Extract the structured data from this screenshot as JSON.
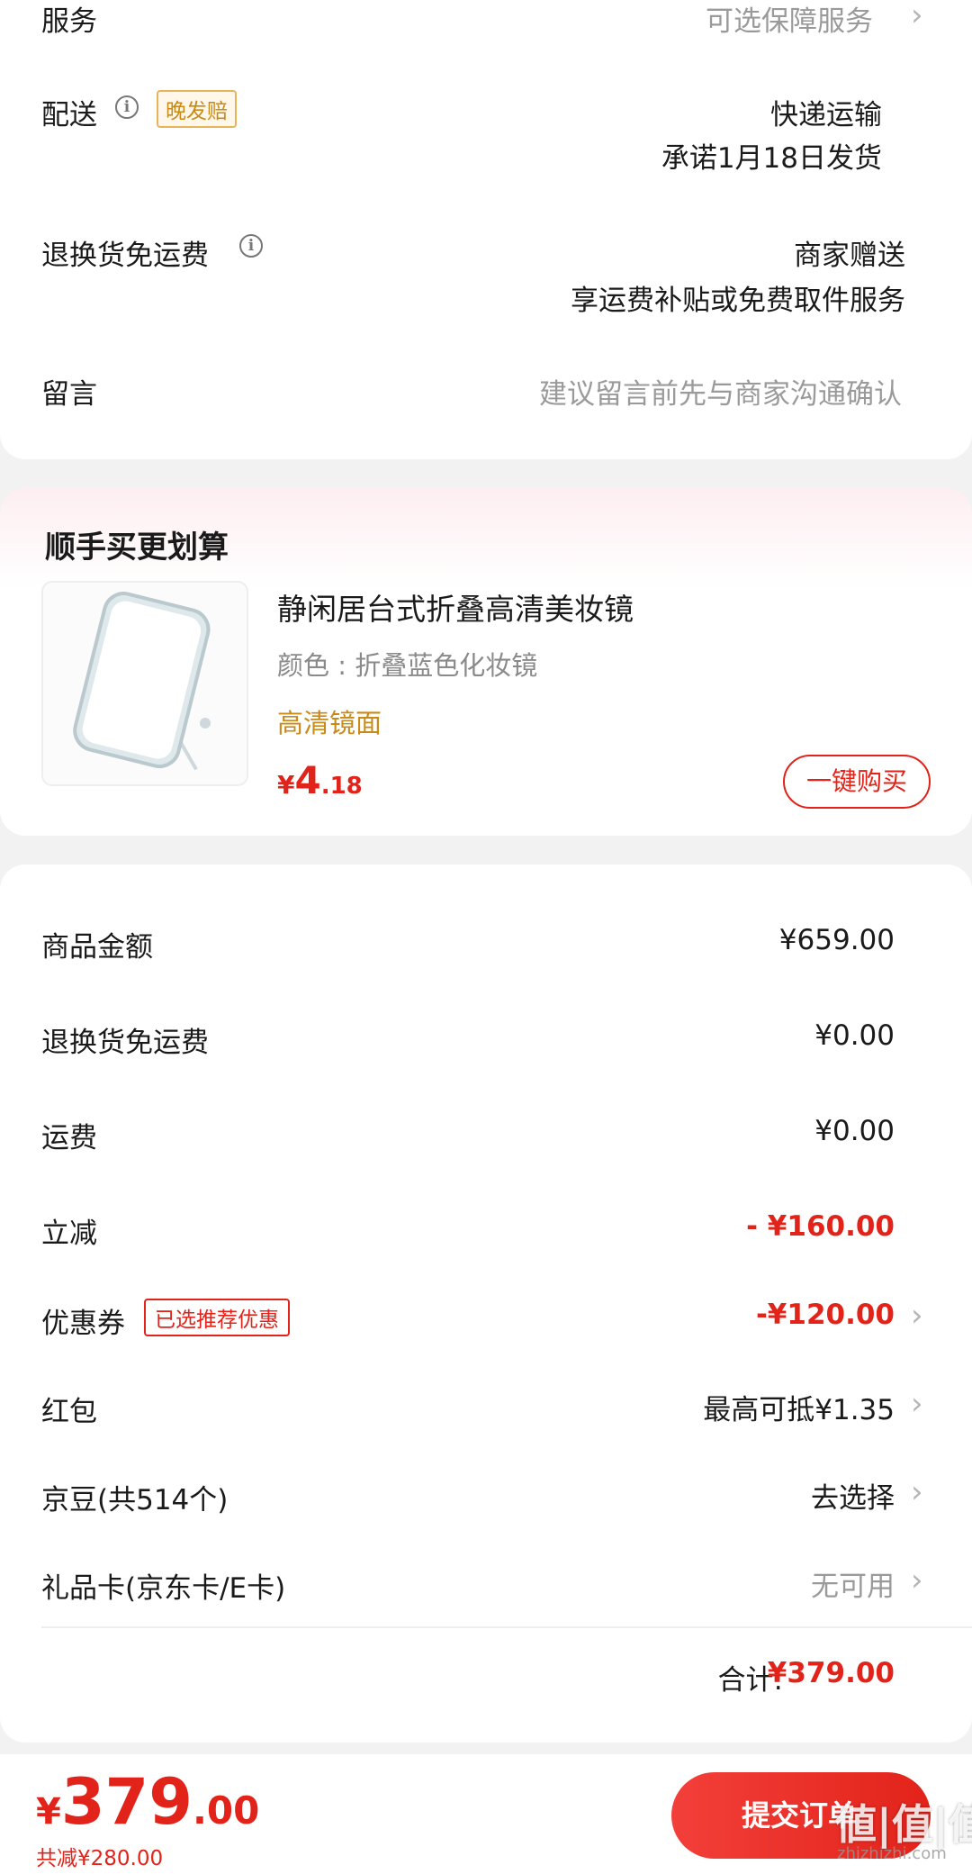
{
  "service": {
    "label": "服务",
    "value": "可选保障服务"
  },
  "delivery": {
    "label": "配送",
    "badge": "晚发赔",
    "method": "快递运输",
    "promise": "承诺1月18日发货"
  },
  "return_shipping": {
    "label": "退换货免运费",
    "value": "商家赠送",
    "desc": "享运费补贴或免费取件服务"
  },
  "message": {
    "label": "留言",
    "placeholder": "建议留言前先与商家沟通确认"
  },
  "addon": {
    "section_title": "顺手买更划算",
    "product_title": "静闲居台式折叠高清美妆镜",
    "spec": "颜色 : 折叠蓝色化妆镜",
    "feature": "高清镜面",
    "price_symbol": "¥",
    "price_int": "4",
    "price_dec": ".18",
    "buy_label": "一键购买"
  },
  "summary": {
    "goods_amount_label": "商品金额",
    "goods_amount": "¥659.00",
    "return_fee_label": "退换货免运费",
    "return_fee": "¥0.00",
    "shipping_label": "运费",
    "shipping": "¥0.00",
    "discount_label": "立减",
    "discount": "- ¥160.00",
    "coupon_label": "优惠券",
    "coupon_tag": "已选推荐优惠",
    "coupon_value": "-¥120.00",
    "redpacket_label": "红包",
    "redpacket_value": "最高可抵¥1.35",
    "jingdou_label": "京豆(共514个)",
    "jingdou_value": "去选择",
    "giftcard_label": "礼品卡(京东卡/E卡)",
    "giftcard_value": "无可用",
    "total_label": "合计:",
    "total_value": "¥379.00"
  },
  "bottom": {
    "currency": "¥",
    "amount_int": "379",
    "amount_dec": ".00",
    "saved": "共减¥280.00",
    "submit_label": "提交订单",
    "watermark": "値|值|值",
    "watermark_url": "zhizhizhi.com"
  },
  "colors": {
    "accent": "#e2231a",
    "gold": "#c98a18"
  }
}
